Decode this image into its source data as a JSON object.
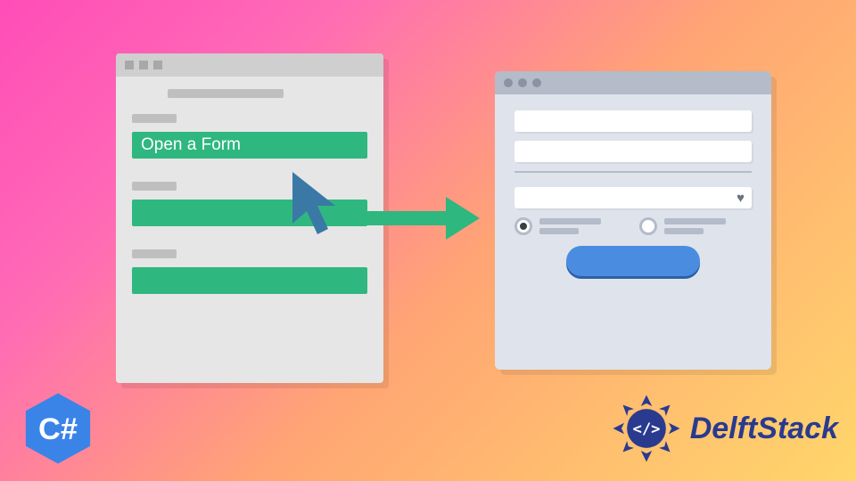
{
  "leftWindow": {
    "button_label": "Open a Form"
  },
  "logos": {
    "csharp_label": "C#",
    "brand_name": "DelftStack",
    "brand_icon_text": "</>"
  },
  "colors": {
    "green": "#2fb780",
    "blue_btn": "#4a8de0",
    "brand_blue": "#2a3a8f"
  }
}
